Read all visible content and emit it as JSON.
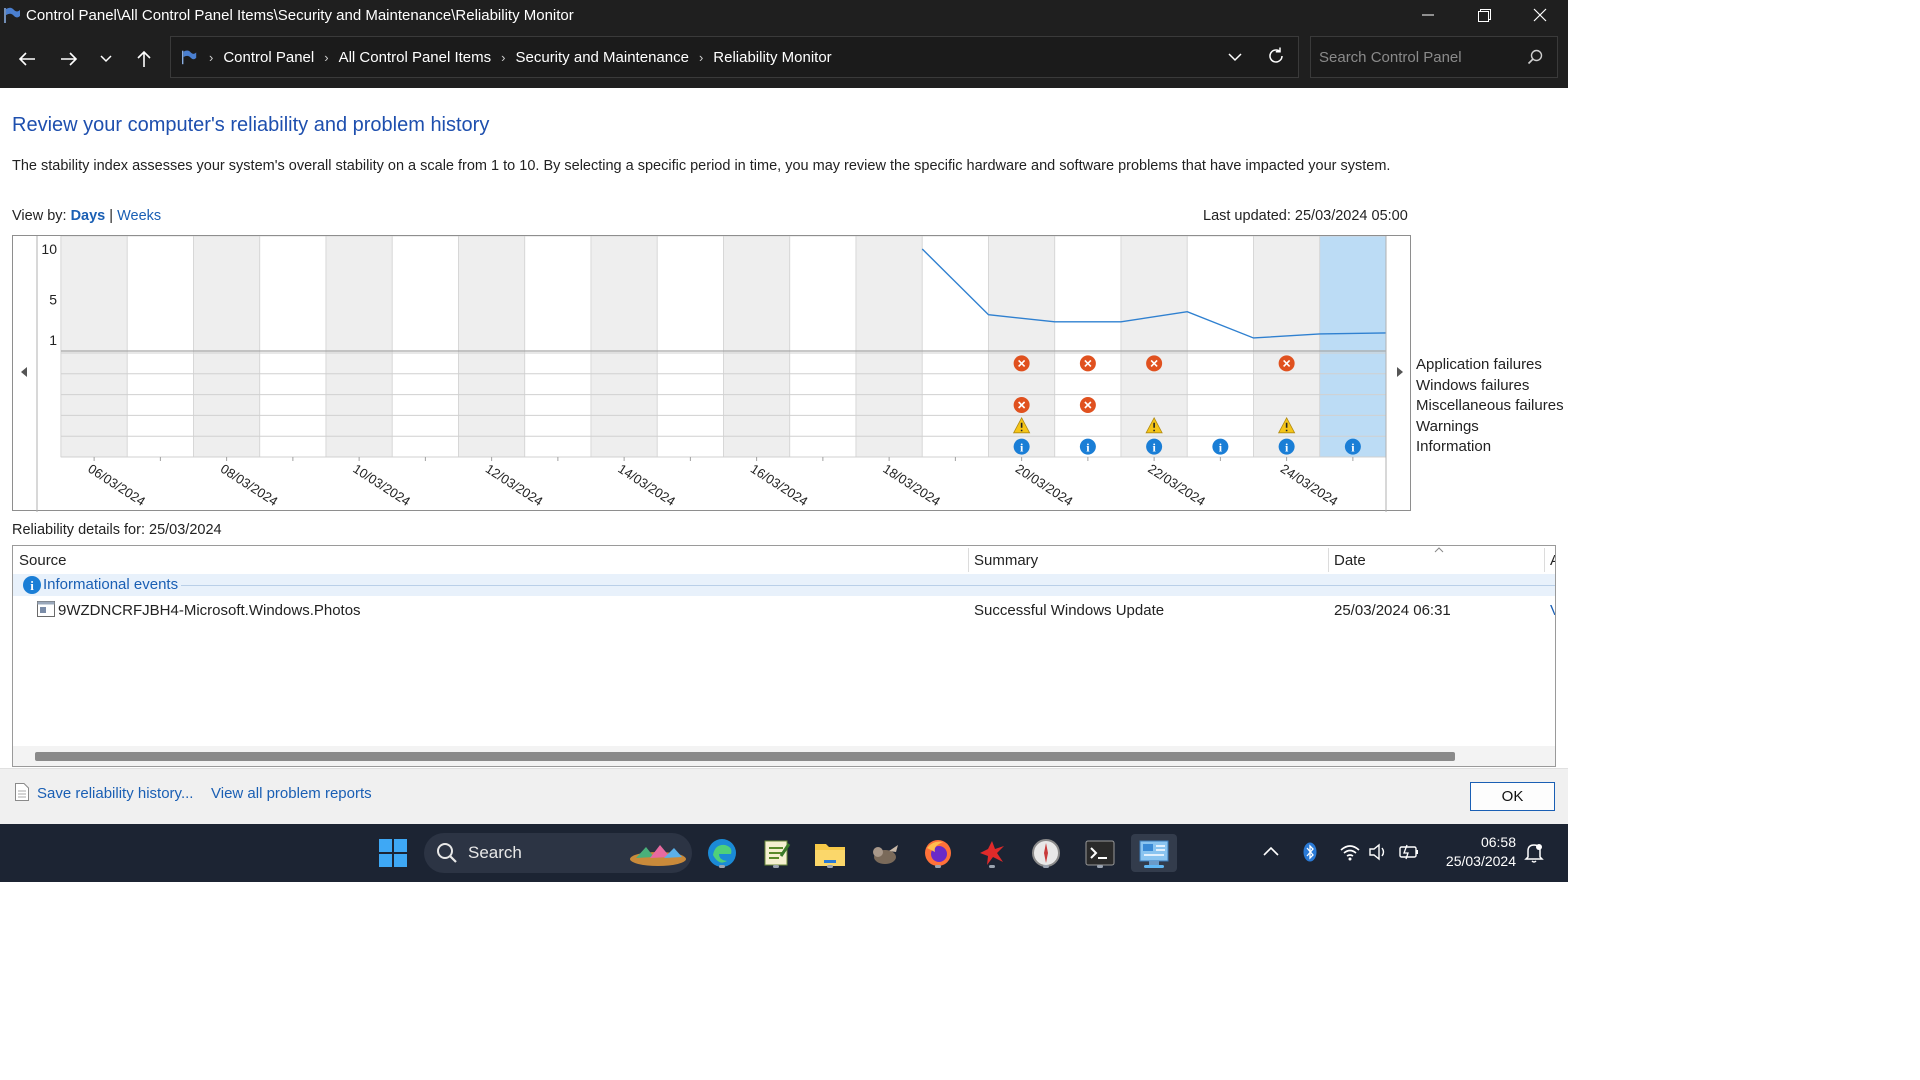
{
  "window": {
    "title": "Control Panel\\All Control Panel Items\\Security and Maintenance\\Reliability Monitor"
  },
  "address": {
    "crumbs": [
      "Control Panel",
      "All Control Panel Items",
      "Security and Maintenance",
      "Reliability Monitor"
    ],
    "search_placeholder": "Search Control Panel"
  },
  "content": {
    "heading": "Review your computer's reliability and problem history",
    "description": "The stability index assesses your system's overall stability on a scale from 1 to 10. By selecting a specific period in time, you may review the specific hardware and software problems that have impacted your system.",
    "view_by_label": "View by:",
    "view_days": "Days",
    "view_sep": "|",
    "view_weeks": "Weeks",
    "last_updated": "Last updated: 25/03/2024 05:00"
  },
  "chart_data": {
    "type": "line",
    "y_ticks": [
      "10",
      "5",
      "1"
    ],
    "ylim": [
      1,
      10
    ],
    "x_dates": [
      "06/03/2024",
      "07/03/2024",
      "08/03/2024",
      "09/03/2024",
      "10/03/2024",
      "11/03/2024",
      "12/03/2024",
      "13/03/2024",
      "14/03/2024",
      "15/03/2024",
      "16/03/2024",
      "17/03/2024",
      "18/03/2024",
      "19/03/2024",
      "20/03/2024",
      "21/03/2024",
      "22/03/2024",
      "23/03/2024",
      "24/03/2024",
      "25/03/2024"
    ],
    "x_tick_labels": [
      "06/03/2024",
      "08/03/2024",
      "10/03/2024",
      "12/03/2024",
      "14/03/2024",
      "16/03/2024",
      "18/03/2024",
      "20/03/2024",
      "22/03/2024",
      "24/03/2024"
    ],
    "stability_line": [
      {
        "x": "19/03/2024",
        "y": 10.0
      },
      {
        "x": "20/03/2024",
        "y": 3.5
      },
      {
        "x": "21/03/2024",
        "y": 2.8
      },
      {
        "x": "22/03/2024",
        "y": 2.8
      },
      {
        "x": "23/03/2024",
        "y": 3.8
      },
      {
        "x": "24/03/2024",
        "y": 1.2
      },
      {
        "x": "25/03/2024",
        "y": 1.6
      }
    ],
    "selected_date": "25/03/2024",
    "rows": [
      "Application failures",
      "Windows failures",
      "Miscellaneous failures",
      "Warnings",
      "Information"
    ],
    "events": [
      {
        "date": "20/03/2024",
        "row": "Application failures",
        "kind": "error"
      },
      {
        "date": "21/03/2024",
        "row": "Application failures",
        "kind": "error"
      },
      {
        "date": "22/03/2024",
        "row": "Application failures",
        "kind": "error"
      },
      {
        "date": "24/03/2024",
        "row": "Application failures",
        "kind": "error"
      },
      {
        "date": "20/03/2024",
        "row": "Miscellaneous failures",
        "kind": "error"
      },
      {
        "date": "21/03/2024",
        "row": "Miscellaneous failures",
        "kind": "error"
      },
      {
        "date": "20/03/2024",
        "row": "Warnings",
        "kind": "warning"
      },
      {
        "date": "22/03/2024",
        "row": "Warnings",
        "kind": "warning"
      },
      {
        "date": "24/03/2024",
        "row": "Warnings",
        "kind": "warning"
      },
      {
        "date": "20/03/2024",
        "row": "Information",
        "kind": "info"
      },
      {
        "date": "21/03/2024",
        "row": "Information",
        "kind": "info"
      },
      {
        "date": "22/03/2024",
        "row": "Information",
        "kind": "info"
      },
      {
        "date": "23/03/2024",
        "row": "Information",
        "kind": "info"
      },
      {
        "date": "24/03/2024",
        "row": "Information",
        "kind": "info"
      },
      {
        "date": "25/03/2024",
        "row": "Information",
        "kind": "info"
      }
    ],
    "colors": {
      "line": "#2f80d0",
      "selected": "#bcdcf5",
      "shade": "#eeeeee",
      "error": "#e0511f",
      "warning": "#f5c518",
      "info": "#1a7ed6"
    }
  },
  "details": {
    "label": "Reliability details for: 25/03/2024",
    "columns": [
      "Source",
      "Summary",
      "Date",
      "A"
    ],
    "group": "Informational events",
    "rows": [
      {
        "source": "9WZDNCRFJBH4-Microsoft.Windows.Photos",
        "summary": "Successful Windows Update",
        "date": "25/03/2024 06:31",
        "action": "V"
      }
    ]
  },
  "footer": {
    "save_link": "Save reliability history...",
    "view_link": "View all problem reports",
    "ok": "OK"
  },
  "taskbar": {
    "search_label": "Search",
    "time": "06:58",
    "date": "25/03/2024"
  }
}
